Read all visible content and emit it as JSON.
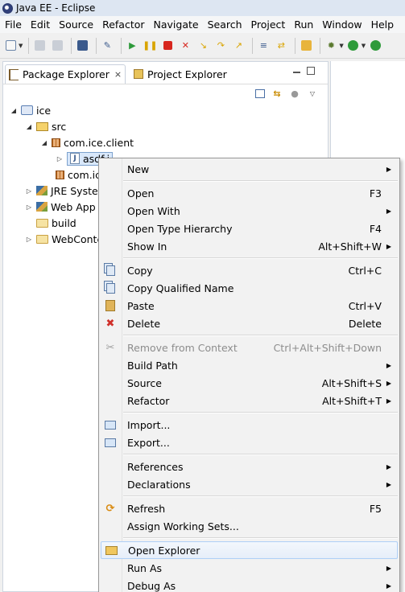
{
  "window": {
    "title": "Java EE - Eclipse"
  },
  "menubar": [
    "File",
    "Edit",
    "Source",
    "Refactor",
    "Navigate",
    "Search",
    "Project",
    "Run",
    "Window",
    "Help"
  ],
  "tabs": {
    "package_explorer": "Package Explorer",
    "project_explorer": "Project Explorer"
  },
  "tree": {
    "project": "ice",
    "src": "src",
    "pkg1": "com.ice.client",
    "file1": "asdf.j",
    "pkg2": "com.ic",
    "jre": "JRE Syster",
    "webapp": "Web App",
    "build": "build",
    "webcontent": "WebConte"
  },
  "context_menu": {
    "new": {
      "label": "New"
    },
    "open": {
      "label": "Open",
      "shortcut": "F3"
    },
    "open_with": {
      "label": "Open With"
    },
    "open_type_hierarchy": {
      "label": "Open Type Hierarchy",
      "shortcut": "F4"
    },
    "show_in": {
      "label": "Show In",
      "shortcut": "Alt+Shift+W"
    },
    "copy": {
      "label": "Copy",
      "shortcut": "Ctrl+C"
    },
    "copy_qualified_name": {
      "label": "Copy Qualified Name"
    },
    "paste": {
      "label": "Paste",
      "shortcut": "Ctrl+V"
    },
    "delete": {
      "label": "Delete",
      "shortcut": "Delete"
    },
    "remove_from_context": {
      "label": "Remove from Context",
      "shortcut": "Ctrl+Alt+Shift+Down"
    },
    "build_path": {
      "label": "Build Path"
    },
    "source": {
      "label": "Source",
      "shortcut": "Alt+Shift+S"
    },
    "refactor": {
      "label": "Refactor",
      "shortcut": "Alt+Shift+T"
    },
    "import": {
      "label": "Import..."
    },
    "export": {
      "label": "Export..."
    },
    "references": {
      "label": "References"
    },
    "declarations": {
      "label": "Declarations"
    },
    "refresh": {
      "label": "Refresh",
      "shortcut": "F5"
    },
    "assign_working_sets": {
      "label": "Assign Working Sets..."
    },
    "open_explorer": {
      "label": "Open Explorer"
    },
    "run_as": {
      "label": "Run As"
    },
    "debug_as": {
      "label": "Debug As"
    }
  },
  "colors": {
    "menu_hover_border": "#aecff7",
    "selection_bg": "#d9e8fb",
    "delete_icon": "#d0302a"
  }
}
